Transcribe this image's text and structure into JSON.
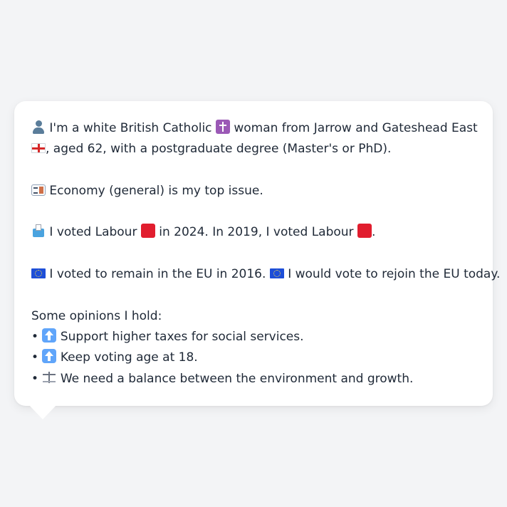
{
  "profile": {
    "line1_a": "I'm a white British Catholic",
    "line1_b": "woman from Jarrow and Gateshead East",
    "line2": ", aged 62, with a postgraduate degree (Master's or PhD).",
    "icons": {
      "person": "person-icon",
      "religion": "cross-icon",
      "flag": "england-flag-icon"
    }
  },
  "top_issue": {
    "text": "Economy (general) is my top issue.",
    "icon": "ledger-icon"
  },
  "votes": {
    "part1": "I voted Labour",
    "part2": "in 2024. In 2019, I voted Labour",
    "part3": ".",
    "party_color": "#e11d2e",
    "icon": "ballot-icon"
  },
  "eu": {
    "part1": "I voted to remain in the EU in 2016.",
    "part2": "I would vote to rejoin the EU today.",
    "icon": "eu-flag-icon"
  },
  "opinions": {
    "heading": "Some opinions I hold:",
    "bullet": "•",
    "items": [
      {
        "icon": "up-arrow-icon",
        "text": "Support higher taxes for social services."
      },
      {
        "icon": "up-arrow-icon",
        "text": "Keep voting age at 18."
      },
      {
        "icon": "scales-icon",
        "text": "We need a balance between the environment and growth."
      }
    ]
  },
  "colors": {
    "background": "#f3f4f6",
    "bubble": "#ffffff",
    "text": "#1f2937"
  }
}
